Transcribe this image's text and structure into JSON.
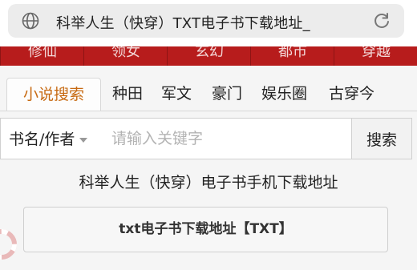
{
  "browser": {
    "url_text": "科举人生（快穿）TXT电子书下载地址_",
    "icons": {
      "site": "globe-icon",
      "reload": "reload-icon"
    }
  },
  "nav": {
    "items": [
      "修仙",
      "领女",
      "玄幻",
      "都市",
      "穿越"
    ]
  },
  "tabs": {
    "active": "小说搜索",
    "items": [
      "种田",
      "军文",
      "豪门",
      "娱乐圈",
      "古穿今"
    ]
  },
  "search": {
    "type_label": "书名/作者",
    "placeholder": "请输入关键字",
    "value": "",
    "button_label": "搜索"
  },
  "main": {
    "heading": "科举人生（快穿）电子书手机下载地址",
    "download_button": "txt电子书下载地址【TXT】"
  },
  "colors": {
    "nav_bg": "#b71c1c",
    "active_tab": "#c76a12"
  }
}
